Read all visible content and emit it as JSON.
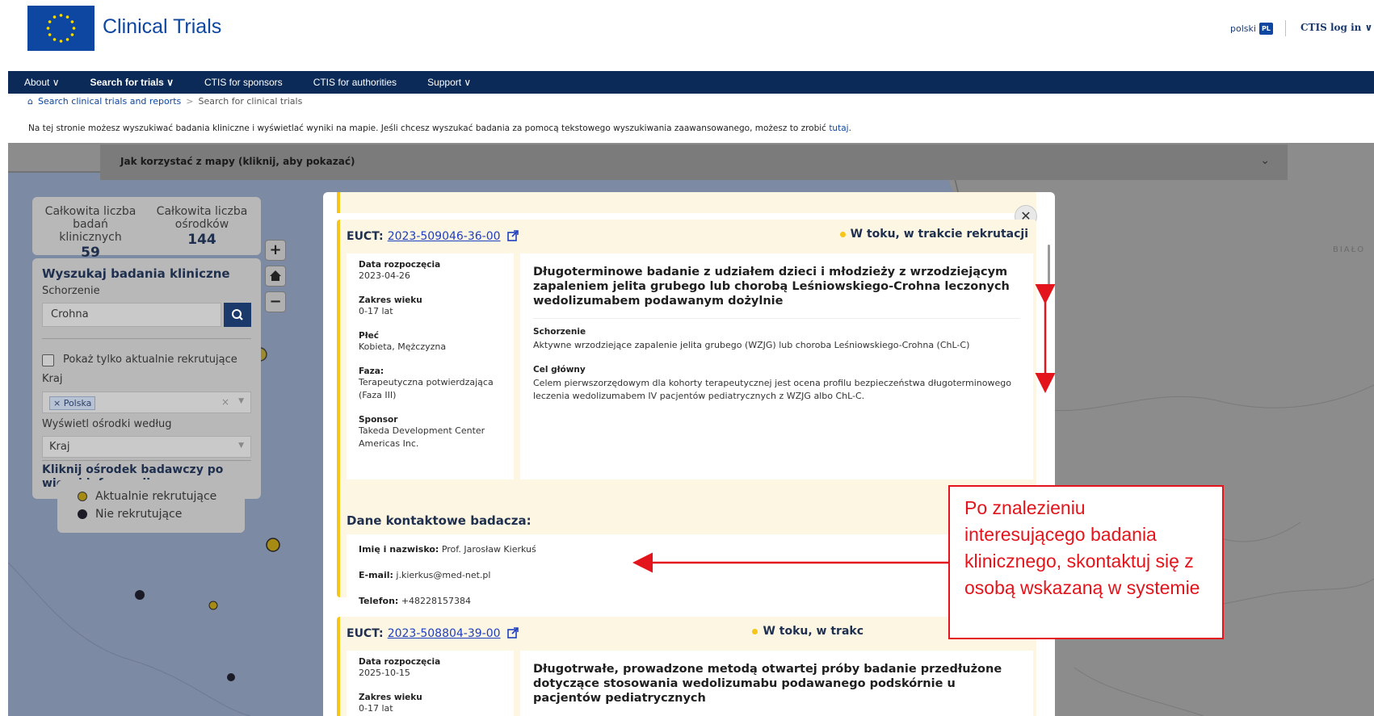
{
  "header": {
    "site_title": "Clinical Trials",
    "lang_label": "polski",
    "lang_badge": "PL",
    "login_label": "CTIS log in ∨"
  },
  "nav": {
    "items": [
      "About ∨",
      "Search for trials ∨",
      "CTIS for sponsors",
      "CTIS for authorities",
      "Support ∨"
    ]
  },
  "breadcrumb": {
    "link": "Search clinical trials and reports",
    "separator": ">",
    "current": "Search for clinical trials"
  },
  "intro": {
    "text": "Na tej stronie możesz wyszukiwać badania kliniczne i wyświetlać wyniki na mapie. Jeśli chcesz wyszukać badania za pomocą tekstowego wyszukiwania zaawansowanego, możesz to zrobić",
    "link": "tutaj",
    "end": "."
  },
  "howto": {
    "label": "Jak korzystać z mapy (kliknij, aby pokazać)"
  },
  "map": {
    "label": "BIAŁO"
  },
  "stats": {
    "trials_label_1": "Całkowita liczba",
    "trials_label_2": "badań klinicznych",
    "trials_count": "59",
    "sites_label_1": "Całkowita liczba",
    "sites_label_2": "ośrodków",
    "sites_count": "144"
  },
  "search": {
    "title": "Wyszukaj badania kliniczne",
    "condition_label": "Schorzenie",
    "condition_value": "Crohna",
    "recruiting_only_label": "Pokaż tylko aktualnie rekrutujące",
    "country_label": "Kraj",
    "country_tag": "× Polska",
    "display_by_label": "Wyświetl ośrodki według",
    "display_by_value": "Kraj",
    "click_hint": "Kliknij ośrodek badawczy po więcej informacji"
  },
  "legend": {
    "recruiting": "Aktualnie rekrutujące",
    "not_recruiting": "Nie rekrutujące"
  },
  "map_controls": {
    "zoom_in": "+",
    "zoom_out": "−"
  },
  "trial1": {
    "euct_label": "EUCT:",
    "euct_number": "2023-509046-36-00",
    "status": "W toku, w trakcie rekrutacji",
    "start_date_label": "Data rozpoczęcia",
    "start_date": "2023-04-26",
    "age_label": "Zakres wieku",
    "age": "0-17 lat",
    "sex_label": "Płeć",
    "sex": "Kobieta, Mężczyzna",
    "phase_label": "Faza:",
    "phase": "Terapeutyczna potwierdzająca (Faza III)",
    "sponsor_label": "Sponsor",
    "sponsor": "Takeda Development Center Americas Inc.",
    "title": "Długoterminowe badanie z udziałem dzieci i młodzieży z wrzodziejącym zapaleniem jelita grubego lub chorobą Leśniowskiego-Crohna leczonych wedolizumabem podawanym dożylnie",
    "condition_label": "Schorzenie",
    "condition": "Aktywne wrzodziejące zapalenie jelita grubego (WZJG) lub choroba Leśniowskiego-Crohna (ChL-C)",
    "objective_label": "Cel główny",
    "objective": "Celem pierwszorzędowym dla kohorty terapeutycznej jest ocena profilu bezpieczeństwa długoterminowego leczenia wedolizumabem IV pacjentów pediatrycznych z WZJG albo ChL-C.",
    "contact_heading": "Dane kontaktowe badacza:",
    "contact_name_label": "Imię i nazwisko:",
    "contact_name": "Prof. Jarosław Kierkuś",
    "contact_email_label": "E-mail:",
    "contact_email": "j.kierkus@med-net.pl",
    "contact_phone_label": "Telefon:",
    "contact_phone": "+48228157384"
  },
  "trial2": {
    "euct_label": "EUCT:",
    "euct_number": "2023-508804-39-00",
    "status": "W toku, w trakc",
    "start_date_label": "Data rozpoczęcia",
    "start_date": "2025-10-15",
    "age_label": "Zakres wieku",
    "age": "0-17 lat",
    "title": "Długotrwałe, prowadzone metodą otwartej próby badanie przedłużone dotyczące stosowania wedolizumabu podawanego podskórnie u pacjentów pediatrycznych"
  },
  "annotation": {
    "callout_text": "Po znalezieniu interesującego badania klinicznego, skontaktuj się z osobą wskazaną w systemie",
    "color": "#e3141b"
  },
  "colors": {
    "eu_blue": "#0e47a1",
    "nav_bg": "#0b2a57",
    "status_yellow": "#f5c518",
    "card_bg": "#fdf6e3"
  }
}
